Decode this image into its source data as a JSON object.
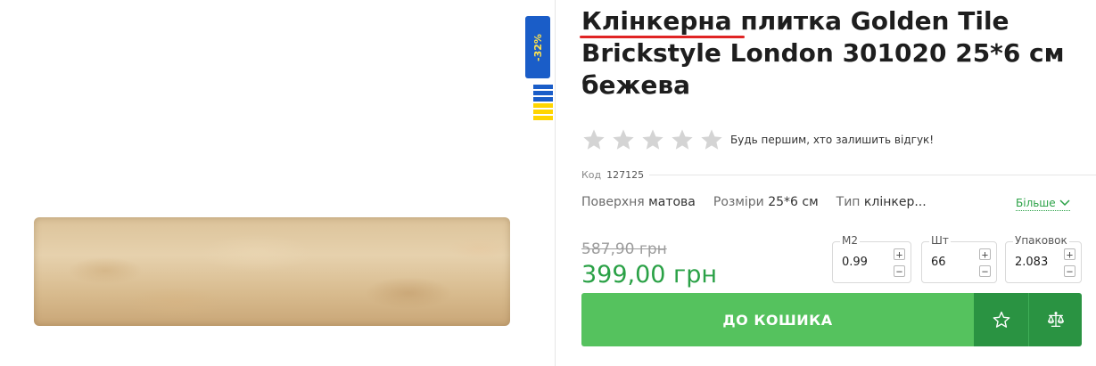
{
  "product": {
    "title": "Клінкерна плитка Golden Tile Brickstyle London 301020 25*6 см бежева",
    "discount_badge": "-32%",
    "image_alt": "Клінкерна плитка Golden Tile Brickstyle London 301020",
    "rating": {
      "stars_filled": 0,
      "stars_total": 5,
      "cta": "Будь першим, хто залишить відгук!"
    },
    "code": {
      "label": "Код",
      "value": "127125"
    },
    "specs": [
      {
        "label": "Поверхня",
        "value": "матова"
      },
      {
        "label": "Розміри",
        "value": "25*6 см"
      },
      {
        "label": "Тип",
        "value": "клінкер..."
      }
    ],
    "more_link": "Більше",
    "price": {
      "old": "587,90 грн",
      "new": "399,00 грн"
    },
    "quantities": [
      {
        "label": "М2",
        "value": "0.99"
      },
      {
        "label": "Шт",
        "value": "66"
      },
      {
        "label": "Упаковок",
        "value": "2.083"
      }
    ],
    "buttons": {
      "add_to_cart": "ДО КОШИКА",
      "plus": "+",
      "minus": "−"
    }
  },
  "colors": {
    "accent_green": "#55c25e",
    "dark_green": "#2a9342",
    "price_green": "#2aa146",
    "badge_blue": "#1a5dc8",
    "badge_yellow": "#ffd500",
    "underline_red": "#e02424"
  },
  "icons": {
    "star": "star-outline-icon",
    "favorite": "star-favorite-icon",
    "compare": "scales-compare-icon",
    "chevron": "chevron-down-icon"
  }
}
